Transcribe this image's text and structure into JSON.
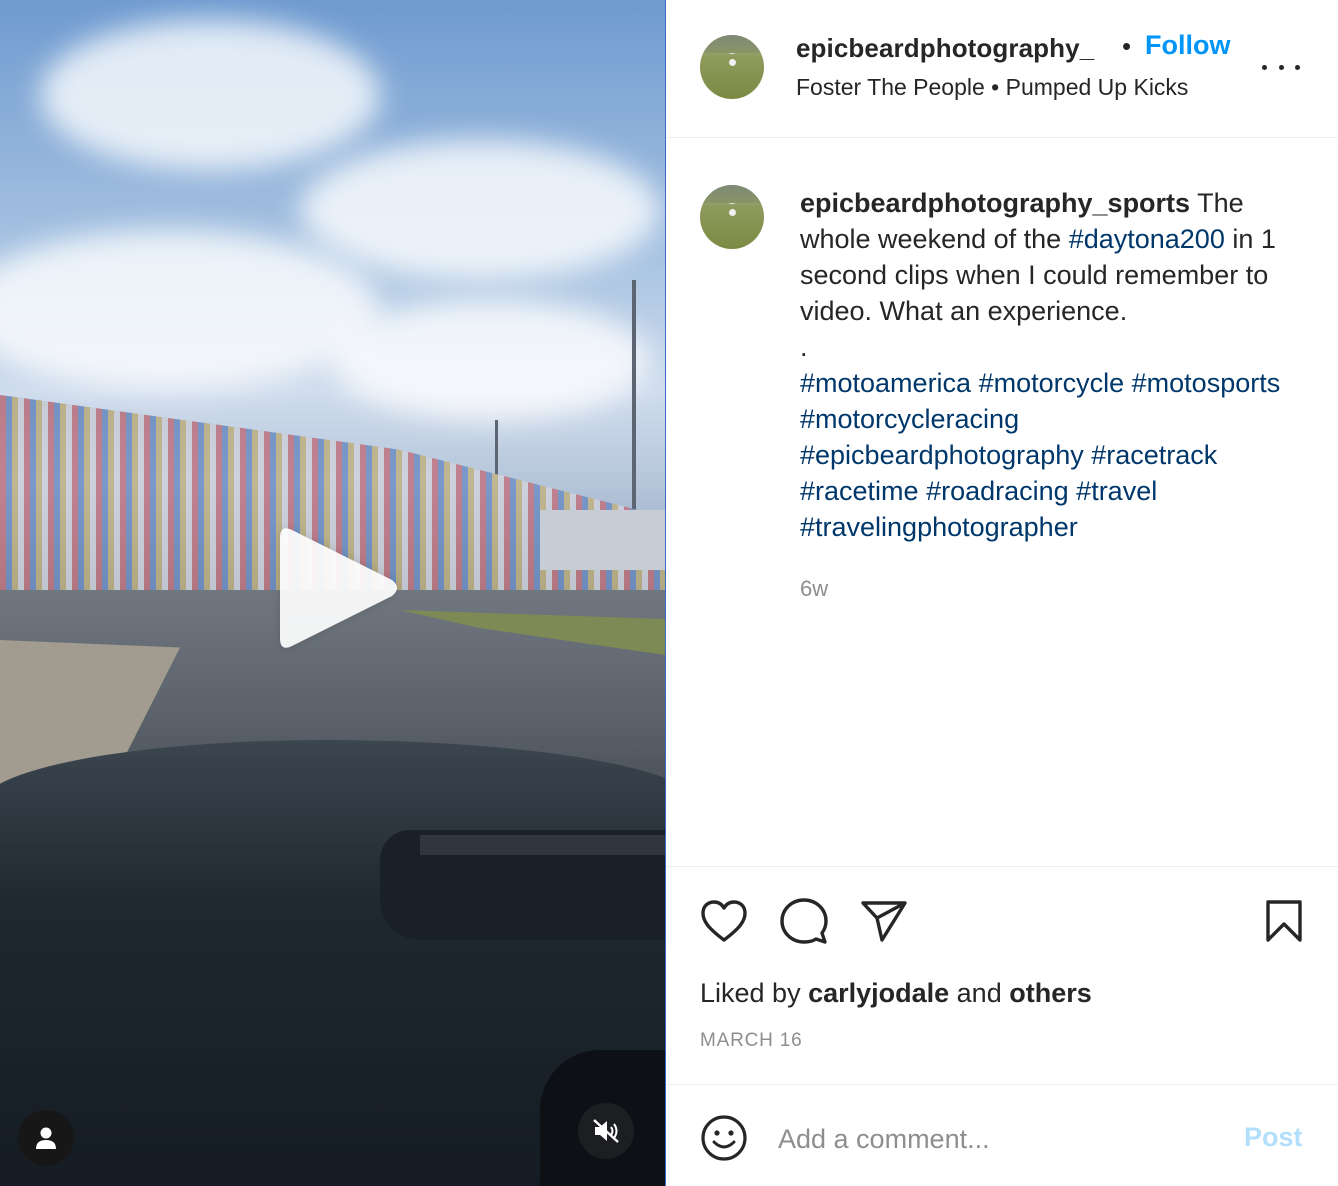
{
  "header": {
    "username": "epicbeardphotography_",
    "dot": "•",
    "follow_label": "Follow",
    "audio": "Foster The People • Pumped Up Kicks"
  },
  "caption": {
    "username": "epicbeardphotography_sports",
    "text_1": " The whole weekend of the ",
    "tag_daytona": "#daytona200",
    "text_2": " in 1 second clips when I could remember to video. What an experience.",
    "separator": ".",
    "hashtags": [
      "#motoamerica",
      "#motorcycle",
      "#motosports",
      "#motorcycleracing",
      "#epicbeardphotography",
      "#racetrack",
      "#racetime",
      "#roadracing",
      "#travel",
      "#travelingphotographer"
    ],
    "time_ago": "6w"
  },
  "engagement": {
    "liked_by_prefix": "Liked by ",
    "liked_by_user": "carlyjodale",
    "liked_by_and": " and ",
    "liked_by_others": "others",
    "date": "MARCH 16"
  },
  "comment_box": {
    "placeholder": "Add a comment...",
    "post_label": "Post"
  },
  "icons": {
    "play": "play-icon",
    "user_tags": "user-icon",
    "mute": "speaker-muted-icon",
    "like": "heart-icon",
    "comment": "comment-bubble-icon",
    "share": "paper-plane-icon",
    "save": "bookmark-icon",
    "emoji": "smiley-icon",
    "more": "more-horizontal-icon"
  },
  "colors": {
    "follow": "#0095f6",
    "hashtag": "#00376b",
    "post_disabled": "#b2dffc",
    "secondary_text": "#8e8e8e"
  }
}
